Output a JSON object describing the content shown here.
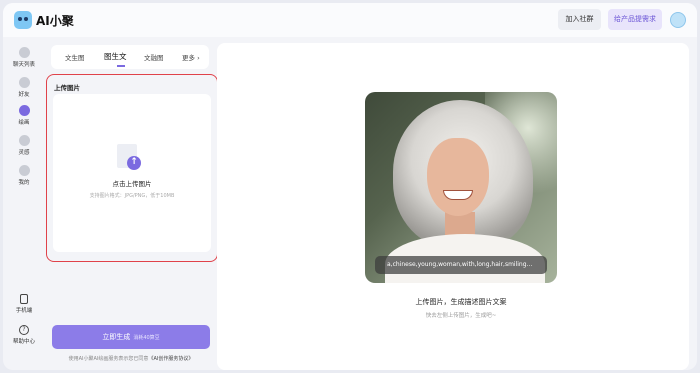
{
  "header": {
    "app_name": "AI小聚",
    "join_button": "加入社群",
    "request_button": "给产品提需求"
  },
  "nav": {
    "items": [
      {
        "label": "聊天列表",
        "icon": "chat-icon"
      },
      {
        "label": "好友",
        "icon": "friend-icon"
      },
      {
        "label": "绘画",
        "icon": "paint-icon",
        "active": true
      },
      {
        "label": "灵感",
        "icon": "inspiration-icon"
      },
      {
        "label": "我的",
        "icon": "profile-icon"
      }
    ],
    "bottom": [
      {
        "label": "手机端",
        "icon": "phone-icon"
      },
      {
        "label": "帮助中心",
        "icon": "help-icon"
      }
    ]
  },
  "tabs": [
    {
      "label": "文生图"
    },
    {
      "label": "图生文",
      "active": true
    },
    {
      "label": "文融图"
    },
    {
      "label": "更多"
    }
  ],
  "upload": {
    "title": "上传图片",
    "label": "点击上传图片",
    "hint": "支持图片格式：JPG/PNG，低于10MB"
  },
  "generate": {
    "label": "立即生成",
    "cost": "消耗40算豆"
  },
  "agreement": {
    "prefix": "使用AI小聚AI绘画服务表示您已同意",
    "link": "《AI创作服务协议》"
  },
  "result": {
    "caption": "a,chinese,young,woman,with,long,hair,smiling...",
    "title": "上传图片，生成描述图片文案",
    "subtitle": "快去左侧上传图片，生成吧~"
  }
}
